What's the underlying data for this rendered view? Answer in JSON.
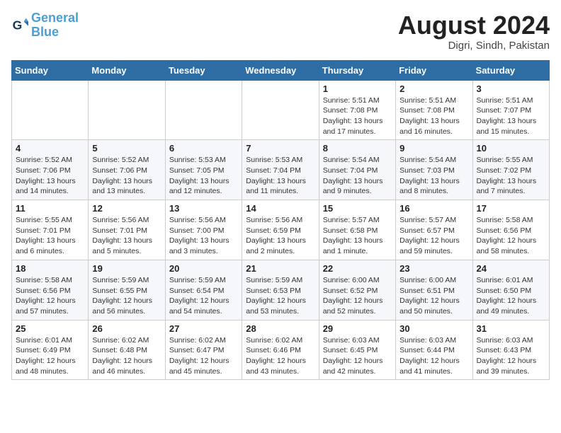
{
  "header": {
    "logo_line1": "General",
    "logo_line2": "Blue",
    "month_year": "August 2024",
    "location": "Digri, Sindh, Pakistan"
  },
  "weekdays": [
    "Sunday",
    "Monday",
    "Tuesday",
    "Wednesday",
    "Thursday",
    "Friday",
    "Saturday"
  ],
  "weeks": [
    [
      {
        "day": "",
        "info": ""
      },
      {
        "day": "",
        "info": ""
      },
      {
        "day": "",
        "info": ""
      },
      {
        "day": "",
        "info": ""
      },
      {
        "day": "1",
        "info": "Sunrise: 5:51 AM\nSunset: 7:08 PM\nDaylight: 13 hours\nand 17 minutes."
      },
      {
        "day": "2",
        "info": "Sunrise: 5:51 AM\nSunset: 7:08 PM\nDaylight: 13 hours\nand 16 minutes."
      },
      {
        "day": "3",
        "info": "Sunrise: 5:51 AM\nSunset: 7:07 PM\nDaylight: 13 hours\nand 15 minutes."
      }
    ],
    [
      {
        "day": "4",
        "info": "Sunrise: 5:52 AM\nSunset: 7:06 PM\nDaylight: 13 hours\nand 14 minutes."
      },
      {
        "day": "5",
        "info": "Sunrise: 5:52 AM\nSunset: 7:06 PM\nDaylight: 13 hours\nand 13 minutes."
      },
      {
        "day": "6",
        "info": "Sunrise: 5:53 AM\nSunset: 7:05 PM\nDaylight: 13 hours\nand 12 minutes."
      },
      {
        "day": "7",
        "info": "Sunrise: 5:53 AM\nSunset: 7:04 PM\nDaylight: 13 hours\nand 11 minutes."
      },
      {
        "day": "8",
        "info": "Sunrise: 5:54 AM\nSunset: 7:04 PM\nDaylight: 13 hours\nand 9 minutes."
      },
      {
        "day": "9",
        "info": "Sunrise: 5:54 AM\nSunset: 7:03 PM\nDaylight: 13 hours\nand 8 minutes."
      },
      {
        "day": "10",
        "info": "Sunrise: 5:55 AM\nSunset: 7:02 PM\nDaylight: 13 hours\nand 7 minutes."
      }
    ],
    [
      {
        "day": "11",
        "info": "Sunrise: 5:55 AM\nSunset: 7:01 PM\nDaylight: 13 hours\nand 6 minutes."
      },
      {
        "day": "12",
        "info": "Sunrise: 5:56 AM\nSunset: 7:01 PM\nDaylight: 13 hours\nand 5 minutes."
      },
      {
        "day": "13",
        "info": "Sunrise: 5:56 AM\nSunset: 7:00 PM\nDaylight: 13 hours\nand 3 minutes."
      },
      {
        "day": "14",
        "info": "Sunrise: 5:56 AM\nSunset: 6:59 PM\nDaylight: 13 hours\nand 2 minutes."
      },
      {
        "day": "15",
        "info": "Sunrise: 5:57 AM\nSunset: 6:58 PM\nDaylight: 13 hours\nand 1 minute."
      },
      {
        "day": "16",
        "info": "Sunrise: 5:57 AM\nSunset: 6:57 PM\nDaylight: 12 hours\nand 59 minutes."
      },
      {
        "day": "17",
        "info": "Sunrise: 5:58 AM\nSunset: 6:56 PM\nDaylight: 12 hours\nand 58 minutes."
      }
    ],
    [
      {
        "day": "18",
        "info": "Sunrise: 5:58 AM\nSunset: 6:56 PM\nDaylight: 12 hours\nand 57 minutes."
      },
      {
        "day": "19",
        "info": "Sunrise: 5:59 AM\nSunset: 6:55 PM\nDaylight: 12 hours\nand 56 minutes."
      },
      {
        "day": "20",
        "info": "Sunrise: 5:59 AM\nSunset: 6:54 PM\nDaylight: 12 hours\nand 54 minutes."
      },
      {
        "day": "21",
        "info": "Sunrise: 5:59 AM\nSunset: 6:53 PM\nDaylight: 12 hours\nand 53 minutes."
      },
      {
        "day": "22",
        "info": "Sunrise: 6:00 AM\nSunset: 6:52 PM\nDaylight: 12 hours\nand 52 minutes."
      },
      {
        "day": "23",
        "info": "Sunrise: 6:00 AM\nSunset: 6:51 PM\nDaylight: 12 hours\nand 50 minutes."
      },
      {
        "day": "24",
        "info": "Sunrise: 6:01 AM\nSunset: 6:50 PM\nDaylight: 12 hours\nand 49 minutes."
      }
    ],
    [
      {
        "day": "25",
        "info": "Sunrise: 6:01 AM\nSunset: 6:49 PM\nDaylight: 12 hours\nand 48 minutes."
      },
      {
        "day": "26",
        "info": "Sunrise: 6:02 AM\nSunset: 6:48 PM\nDaylight: 12 hours\nand 46 minutes."
      },
      {
        "day": "27",
        "info": "Sunrise: 6:02 AM\nSunset: 6:47 PM\nDaylight: 12 hours\nand 45 minutes."
      },
      {
        "day": "28",
        "info": "Sunrise: 6:02 AM\nSunset: 6:46 PM\nDaylight: 12 hours\nand 43 minutes."
      },
      {
        "day": "29",
        "info": "Sunrise: 6:03 AM\nSunset: 6:45 PM\nDaylight: 12 hours\nand 42 minutes."
      },
      {
        "day": "30",
        "info": "Sunrise: 6:03 AM\nSunset: 6:44 PM\nDaylight: 12 hours\nand 41 minutes."
      },
      {
        "day": "31",
        "info": "Sunrise: 6:03 AM\nSunset: 6:43 PM\nDaylight: 12 hours\nand 39 minutes."
      }
    ]
  ]
}
